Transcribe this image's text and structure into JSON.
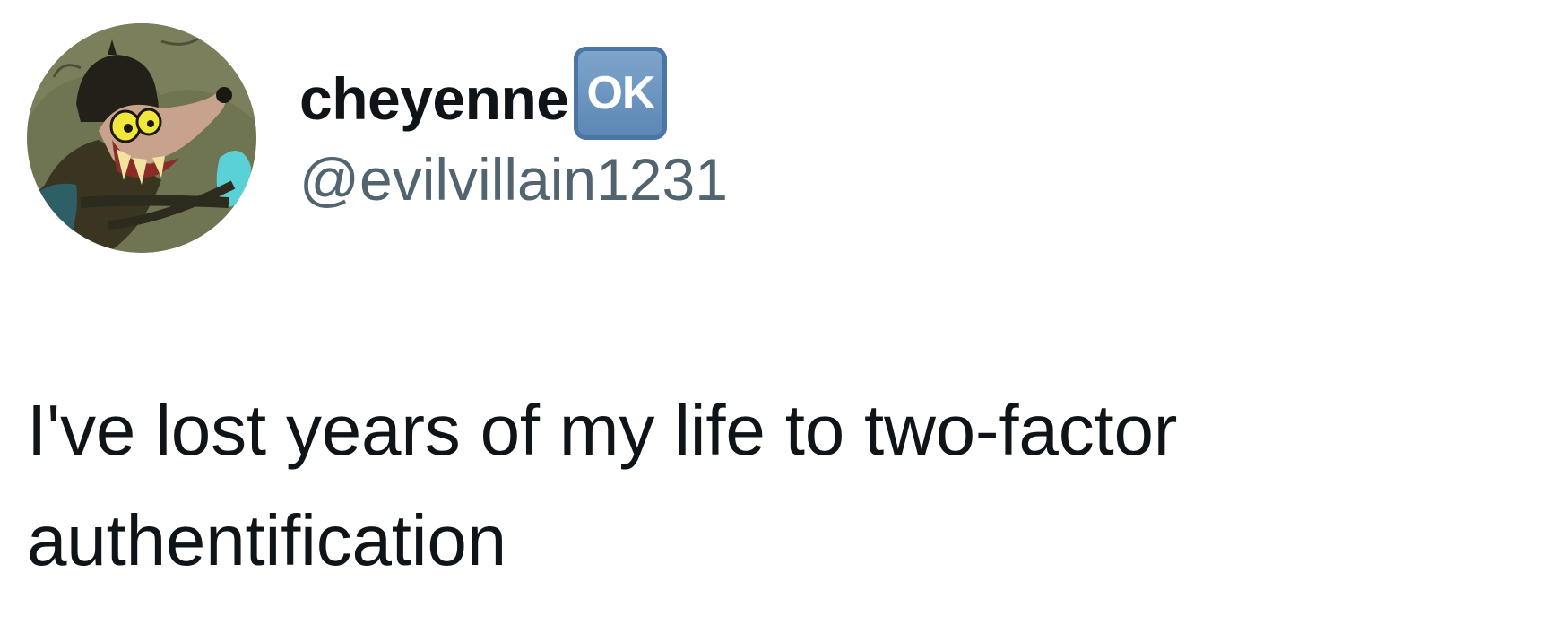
{
  "tweet": {
    "display_name": "cheyenne",
    "badge_text": "OK",
    "handle": "@evilvillain1231",
    "text": "I've lost years of my life to two-factor authentification",
    "avatar_icon": "cartoon-villain-avatar",
    "badge_icon": "ok-button-emoji"
  },
  "colors": {
    "text_primary": "#0f1419",
    "text_secondary": "#536471",
    "badge_blue": "#5b86b4"
  }
}
